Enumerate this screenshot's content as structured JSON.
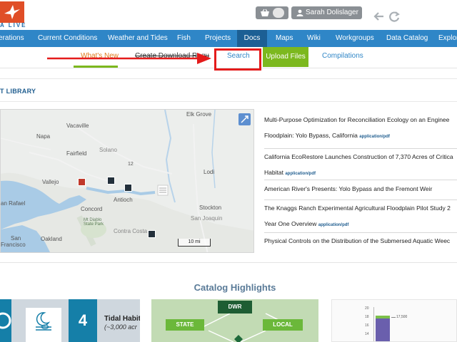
{
  "header": {
    "logo_text": "A LIVE",
    "user_name": "Sarah Dolislager",
    "colors": {
      "logo": "#e04e27",
      "nav": "#2f86c7",
      "nav_active": "#1c5f94",
      "upload": "#7cb81e",
      "highlight": "#e41b1b"
    }
  },
  "topnav": {
    "items": [
      {
        "label": "erations"
      },
      {
        "label": "Current Conditions"
      },
      {
        "label": "Weather and Tides"
      },
      {
        "label": "Fish"
      },
      {
        "label": "Projects"
      },
      {
        "label": "Docs"
      },
      {
        "label": "Maps"
      },
      {
        "label": "Wiki"
      },
      {
        "label": "Workgroups"
      },
      {
        "label": "Data Catalog"
      },
      {
        "label": "Explor"
      }
    ],
    "active": "Docs"
  },
  "subnav": {
    "whats_new": "What's New",
    "create_download": "Create Download Requ",
    "search": "Search",
    "upload": "Upload Files",
    "compilations": "Compilations"
  },
  "section_title": "T LIBRARY",
  "map": {
    "labels": [
      "Elk Grove",
      "Vacaville",
      "Napa",
      "Fairfield",
      "Solano",
      "Lodi",
      "Vallejo",
      "an Rafael",
      "Antioch",
      "Concord",
      "Stockton",
      "San Joaquin",
      "Mt Diablo State Park",
      "Contra Costa",
      "San",
      "Francisco",
      "Oakland",
      "12"
    ],
    "scale": "10 mi"
  },
  "documents": [
    {
      "title": "Multi-Purpose Optimization for Reconciliation Ecology on an Enginee",
      "title2": "Floodplain: Yolo Bypass, California",
      "mime": "application/pdf"
    },
    {
      "title": "California EcoRestore Launches Construction of 7,370 Acres of Critica",
      "title2": "Habitat",
      "mime": "application/pdf"
    },
    {
      "title": "American River's Presents: Yolo Bypass and the Fremont Weir",
      "title2": "",
      "mime": ""
    },
    {
      "title": "The Knaggs Ranch Experimental Agricultural Floodplain Pilot Study 2",
      "title2": "Year One Overview",
      "mime": "application/pdf"
    },
    {
      "title": "Physical Controls on the Distribution of the Submersed Aquatic Weec",
      "title2": "",
      "mime": ""
    }
  ],
  "highlights": {
    "title": "Catalog Highlights",
    "card1": {
      "number": "4",
      "label": "Tidal Habit",
      "sublabel": "(~3,000 acr"
    },
    "card2": {
      "top": "DWR",
      "left": "STATE",
      "right": "LOCAL"
    },
    "card3": {
      "value_label": "17,500",
      "ticks": [
        "20",
        "18",
        "16",
        "14"
      ]
    }
  }
}
